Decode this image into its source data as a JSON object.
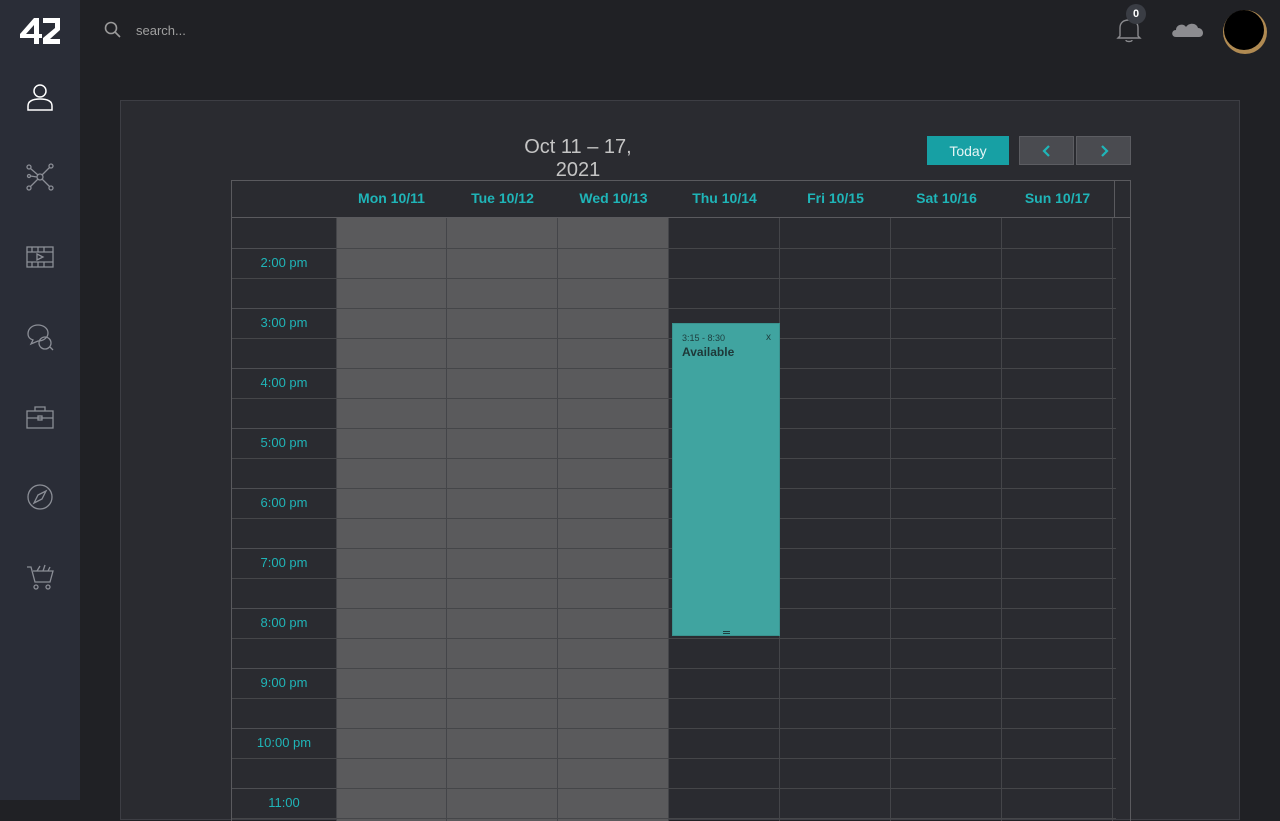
{
  "app": {
    "logo_text": "42"
  },
  "sidebar": {
    "items": [
      {
        "icon": "user-icon"
      },
      {
        "icon": "network-icon"
      },
      {
        "icon": "video-icon"
      },
      {
        "icon": "chat-icon"
      },
      {
        "icon": "briefcase-icon"
      },
      {
        "icon": "compass-icon"
      },
      {
        "icon": "cart-icon"
      }
    ]
  },
  "topbar": {
    "search_placeholder": "search...",
    "notifications_count": "0"
  },
  "calendar": {
    "title": "Oct 11 – 17, 2021",
    "today_label": "Today",
    "prev_label": "‹",
    "next_label": "›",
    "days": [
      "Mon 10/11",
      "Tue 10/12",
      "Wed 10/13",
      "Thu 10/14",
      "Fri 10/15",
      "Sat 10/16",
      "Sun 10/17"
    ],
    "disabled_days": [
      "Mon 10/11",
      "Tue 10/12",
      "Wed 10/13"
    ],
    "time_labels": [
      "2:00 pm",
      "3:00 pm",
      "4:00 pm",
      "5:00 pm",
      "6:00 pm",
      "7:00 pm",
      "8:00 pm",
      "9:00 pm",
      "10:00 pm",
      "11:00"
    ],
    "event": {
      "day": "Thu 10/14",
      "time": "3:15 - 8:30",
      "title": "Available",
      "close": "x"
    }
  },
  "colors": {
    "accent": "#1fb5b8",
    "event_bg": "#40a4a0",
    "sidebar_bg": "#2a2d37"
  }
}
